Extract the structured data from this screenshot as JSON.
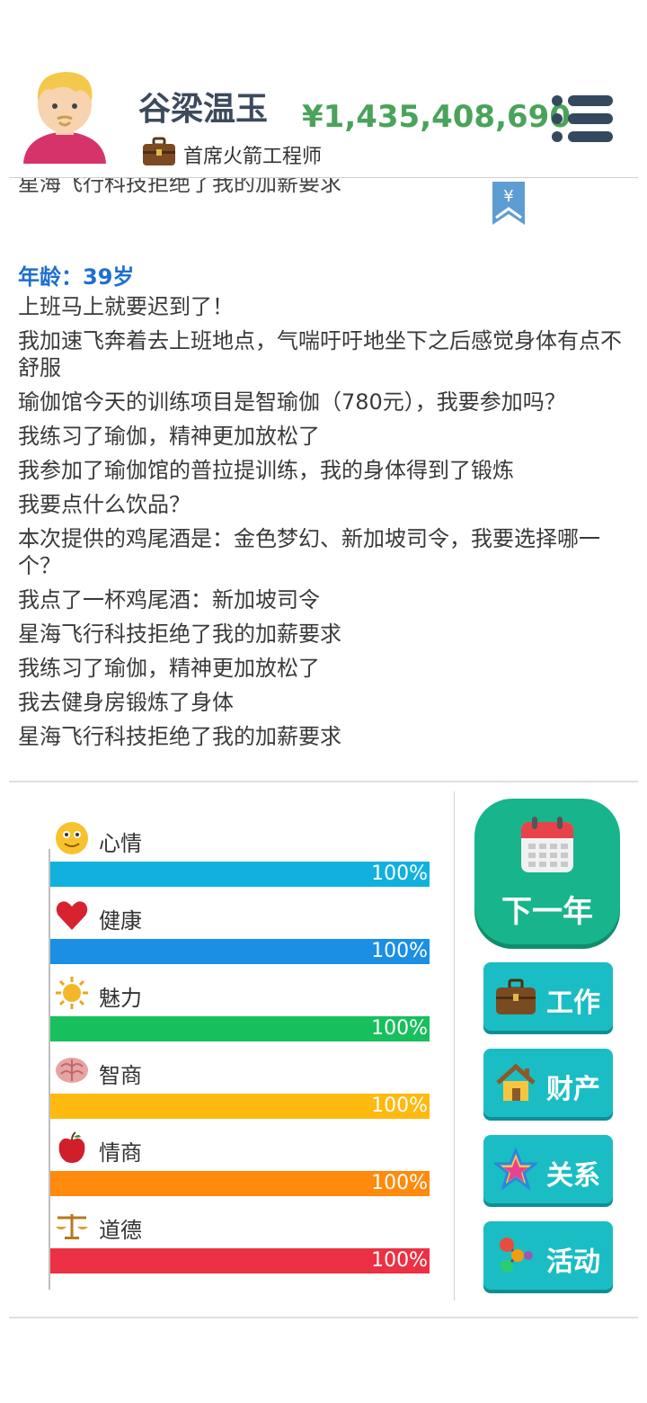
{
  "header": {
    "name": "谷梁温玉",
    "job_title": "首席火箭工程师",
    "money": "¥1,435,408,690"
  },
  "log": {
    "cut_off_line": "星海飞行科技拒绝了我的加薪要求",
    "bookmark_symbol": "¥",
    "age": "年龄：39岁",
    "lines": [
      "上班马上就要迟到了！",
      "我加速飞奔着去上班地点，气喘吁吁地坐下之后感觉身体有点不舒服",
      "瑜伽馆今天的训练项目是智瑜伽（780元），我要参加吗？",
      "我练习了瑜伽，精神更加放松了",
      "我参加了瑜伽馆的普拉提训练，我的身体得到了锻炼",
      "我要点什么饮品？",
      "本次提供的鸡尾酒是：金色梦幻、新加坡司令，我要选择哪一个？",
      "我点了一杯鸡尾酒：新加坡司令",
      "星海飞行科技拒绝了我的加薪要求",
      "我练习了瑜伽，精神更加放松了",
      "我去健身房锻炼了身体",
      "星海飞行科技拒绝了我的加薪要求"
    ]
  },
  "stats": [
    {
      "label": "心情",
      "value": 100,
      "value_text": "100%",
      "color": "#12b1dd",
      "icon": "smiley-icon"
    },
    {
      "label": "健康",
      "value": 100,
      "value_text": "100%",
      "color": "#1a8fe3",
      "icon": "heart-icon"
    },
    {
      "label": "魅力",
      "value": 100,
      "value_text": "100%",
      "color": "#17c05c",
      "icon": "sun-icon"
    },
    {
      "label": "智商",
      "value": 100,
      "value_text": "100%",
      "color": "#ffb90f",
      "icon": "brain-icon"
    },
    {
      "label": "情商",
      "value": 100,
      "value_text": "100%",
      "color": "#ff8a0c",
      "icon": "apple-icon"
    },
    {
      "label": "道德",
      "value": 100,
      "value_text": "100%",
      "color": "#ec3144",
      "icon": "scales-icon"
    }
  ],
  "buttons": {
    "next_year": "下一年",
    "work": "工作",
    "property": "财产",
    "relations": "关系",
    "activities": "活动"
  }
}
